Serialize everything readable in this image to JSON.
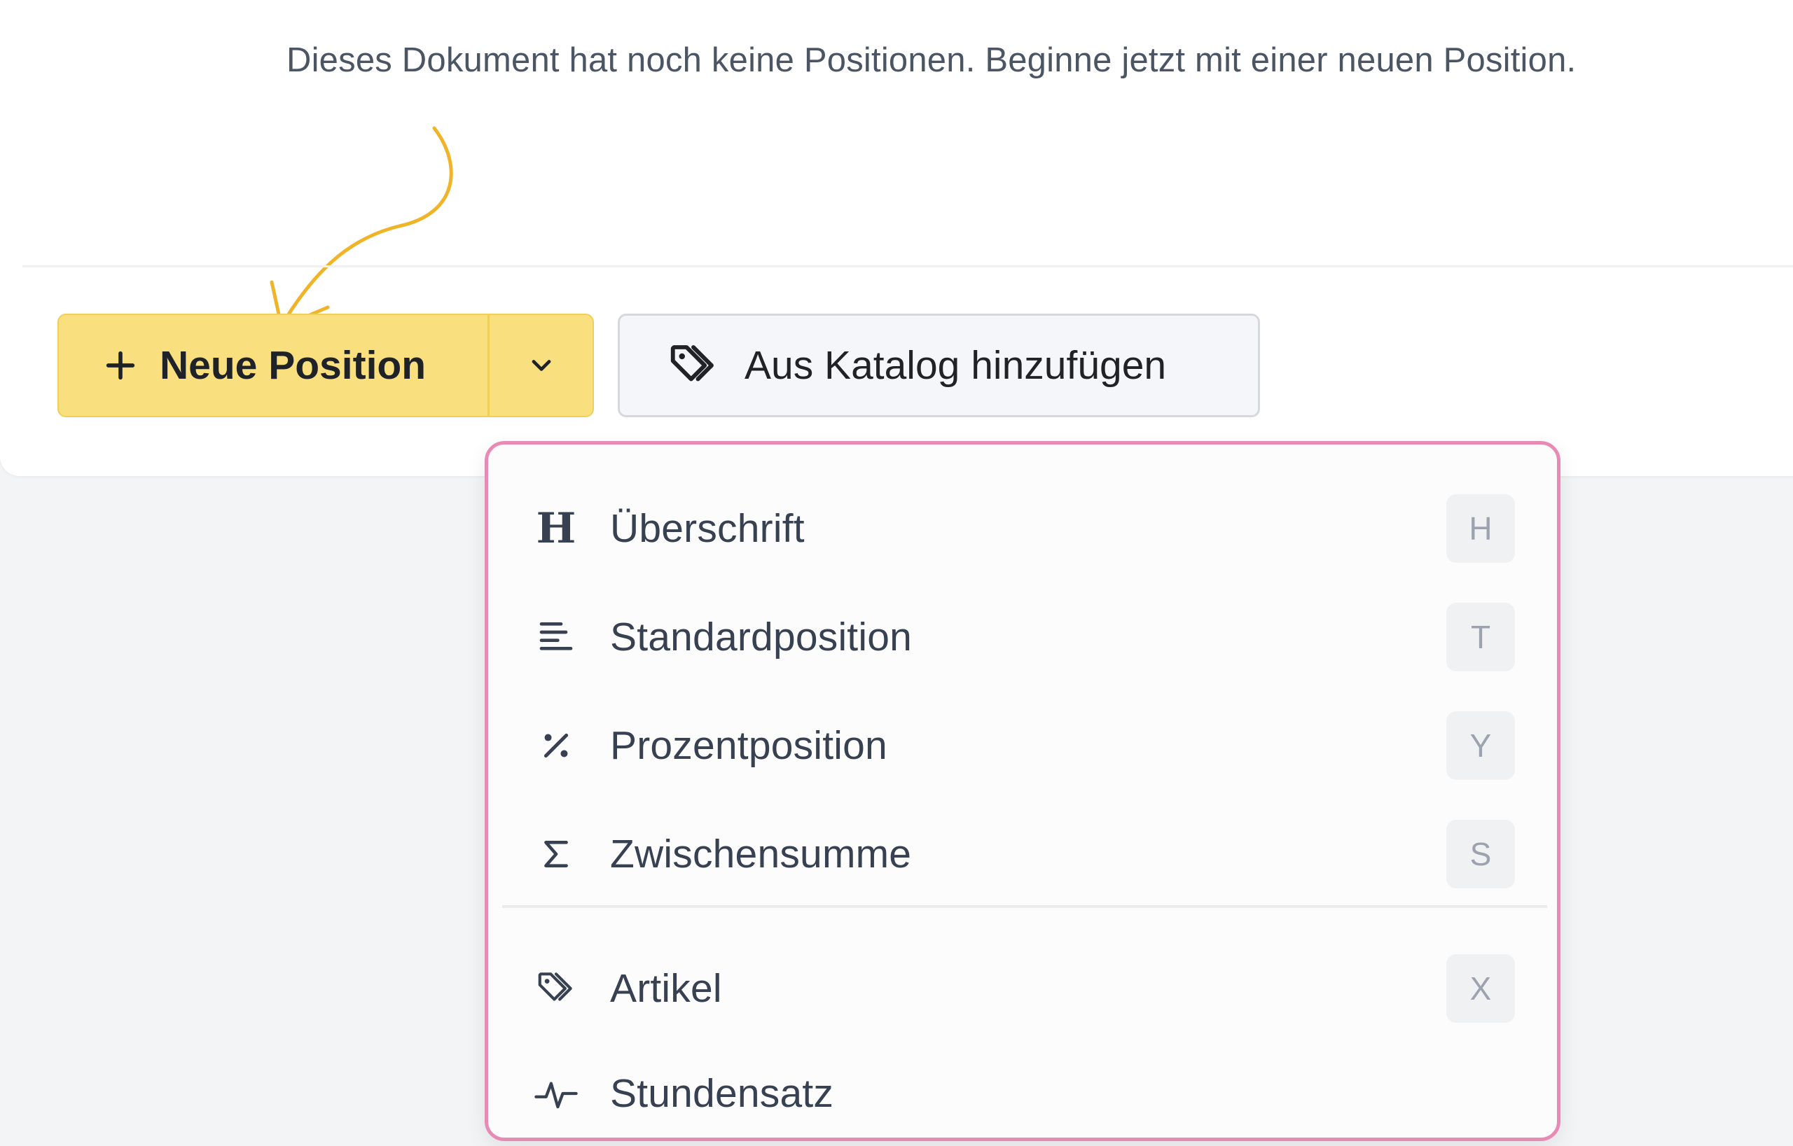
{
  "empty_state": {
    "message": "Dieses Dokument hat noch keine Positionen. Beginne jetzt mit einer neuen Position."
  },
  "toolbar": {
    "new_position_label": "Neue Position",
    "catalog_label": "Aus Katalog hinzufügen"
  },
  "colors": {
    "primary_button": "#f9df7e",
    "menu_border": "#e88bb4",
    "arrow_hint": "#f0b429"
  },
  "dropdown": {
    "items": [
      {
        "label": "Überschrift",
        "shortcut": "H",
        "icon": "heading-icon"
      },
      {
        "label": "Standardposition",
        "shortcut": "T",
        "icon": "text-lines-icon"
      },
      {
        "label": "Prozentposition",
        "shortcut": "Y",
        "icon": "percent-icon"
      },
      {
        "label": "Zwischensumme",
        "shortcut": "S",
        "icon": "sigma-icon"
      },
      {
        "label": "Artikel",
        "shortcut": "X",
        "icon": "tag-icon"
      },
      {
        "label": "Stundensatz",
        "shortcut": "",
        "icon": "activity-icon"
      }
    ]
  }
}
